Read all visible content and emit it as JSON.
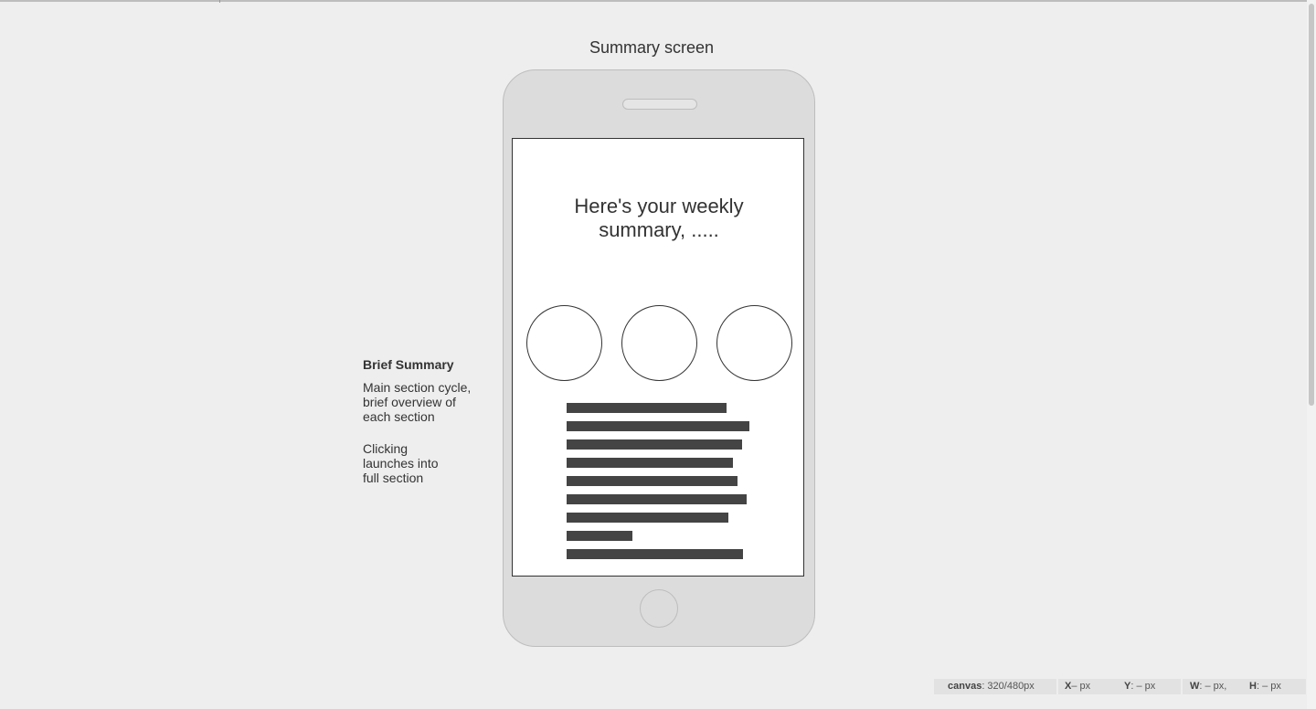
{
  "page": {
    "title": "Summary screen"
  },
  "phone": {
    "headline_line1": "Here's your weekly",
    "headline_line2": "summary, .....",
    "circle_count": 3,
    "text_bar_count": 9
  },
  "annotation": {
    "title": "Brief Summary",
    "p1": [
      "Main section cycle,",
      "brief overview of",
      "each section"
    ],
    "p2": [
      "Clicking",
      "launches into",
      "full section"
    ]
  },
  "statusbar": {
    "canvas_label": "canvas",
    "canvas_value": ": 320/480px",
    "x_label": "X",
    "x_value": " – px",
    "y_label": "Y",
    "y_value": ": – px",
    "w_label": "W",
    "w_value": ": – px,",
    "h_label": "H",
    "h_value": ": – px"
  }
}
